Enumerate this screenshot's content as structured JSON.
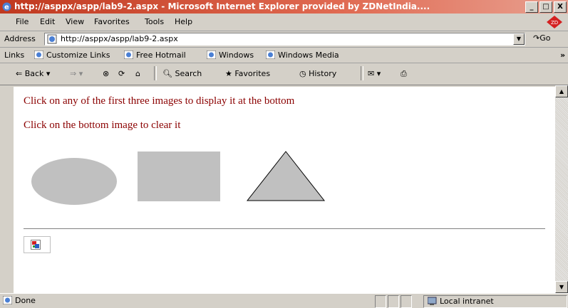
{
  "window": {
    "title": "http://asppx/aspp/lab9-2.aspx - Microsoft Internet Explorer provided by ZDNetIndia....",
    "buttons": [
      "_",
      "□",
      "X"
    ]
  },
  "menu": {
    "items": [
      "File",
      "Edit",
      "View",
      "Favorites",
      "Tools",
      "Help"
    ]
  },
  "address": {
    "label": "Address",
    "url": "http://asppx/aspp/lab9-2.aspx",
    "go": "Go"
  },
  "links": {
    "label": "Links",
    "items": [
      "Customize Links",
      "Free Hotmail",
      "Windows",
      "Windows Media"
    ]
  },
  "toolbar": {
    "back": "Back",
    "search": "Search",
    "favorites": "Favorites",
    "history": "History"
  },
  "page": {
    "line1": "Click on any of the first three images to display it at the bottom",
    "line2": "Click on the bottom image to clear it"
  },
  "status": {
    "text": "Done",
    "zone": "Local intranet"
  },
  "colors": {
    "title_bar": "#c0391f",
    "page_text": "#8b0000",
    "shape_fill": "#c0c0c0"
  }
}
